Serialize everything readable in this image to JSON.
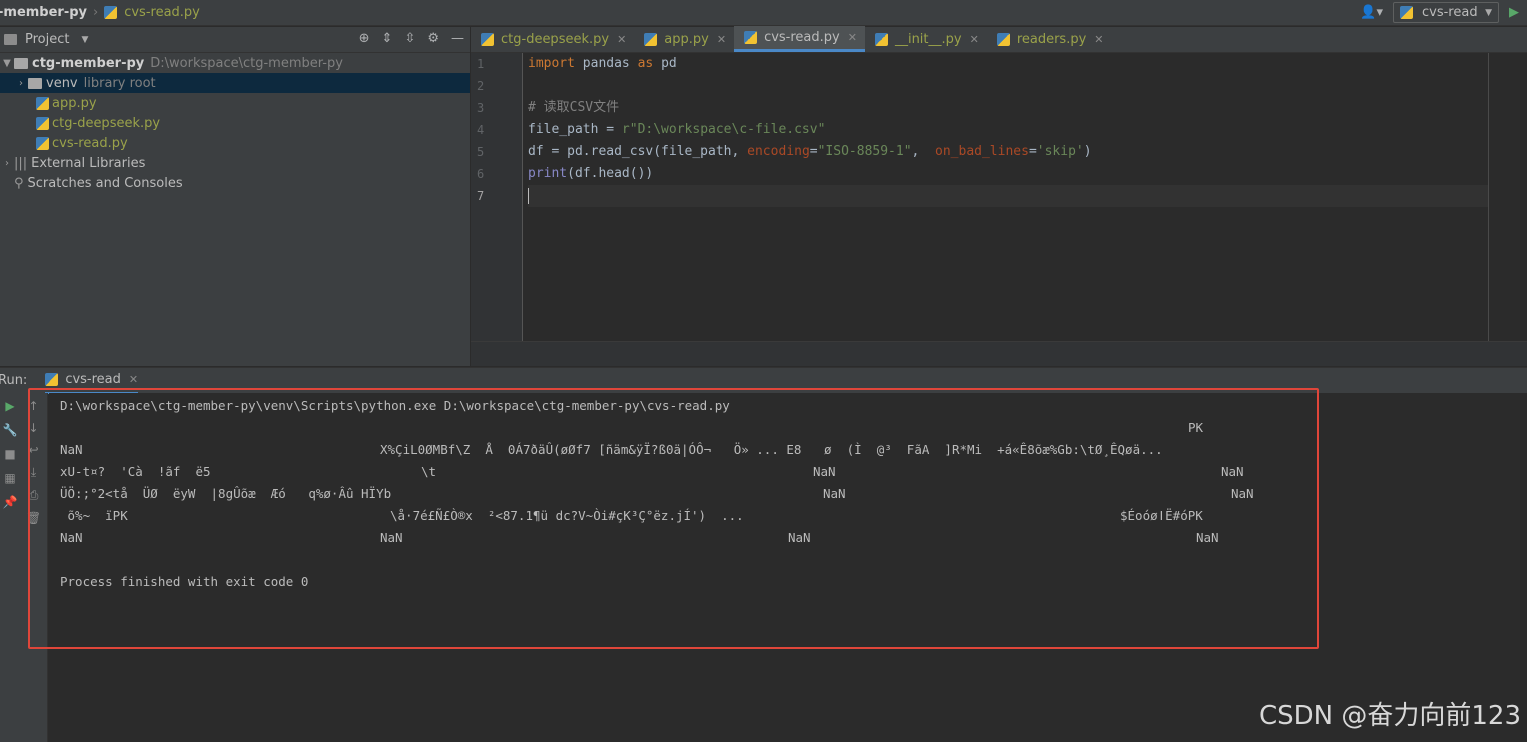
{
  "navbar": {
    "project": "-member-py",
    "file": "cvs-read.py",
    "run_config": "cvs-read"
  },
  "project_panel": {
    "title": "Project",
    "root": {
      "name": "ctg-member-py",
      "path": "D:\\workspace\\ctg-member-py"
    },
    "venv": {
      "name": "venv",
      "hint": "library root"
    },
    "files": [
      "app.py",
      "ctg-deepseek.py",
      "cvs-read.py"
    ],
    "external": "External Libraries",
    "scratches": "Scratches and Consoles"
  },
  "editor": {
    "tabs": [
      "ctg-deepseek.py",
      "app.py",
      "cvs-read.py",
      "__init__.py",
      "readers.py"
    ],
    "active_tab": "cvs-read.py",
    "line_numbers": [
      "1",
      "2",
      "3",
      "4",
      "5",
      "6",
      "7"
    ],
    "code": {
      "l1_kw1": "import",
      "l1_mod": " pandas ",
      "l1_kw2": "as",
      "l1_alias": " pd",
      "l3_comment": "# 读取CSV文件",
      "l4_pre": "file_path = ",
      "l4_str": "r\"D:\\workspace\\c-file.csv\"",
      "l5_pre": "df = pd.read_csv(file_path, ",
      "l5_p1": "encoding",
      "l5_eq1": "=",
      "l5_s1": "\"ISO-8859-1\"",
      "l5_comma": ",  ",
      "l5_p2": "on_bad_lines",
      "l5_eq2": "=",
      "l5_s2": "'skip'",
      "l5_end": ")",
      "l6_fn": "print",
      "l6_rest": "(df.head())"
    }
  },
  "run_panel": {
    "label": "Run:",
    "tab": "cvs-read",
    "console": {
      "cmd": "D:\\workspace\\ctg-member-py\\venv\\Scripts\\python.exe D:\\workspace\\ctg-member-py\\cvs-read.py",
      "r1_right": "PK",
      "r2_c1": "NaN",
      "r2_c2": "X%ÇiL0ØMBf\\Z  Å  0Á7ðäÛ(øØf7 [ñäm&ÿÏ?ß0ä|ÓÔ¬   Ö» ... E8   ø  (Ì  @³  FãA  ]R*Mi  +á«Ê8õæ%Gb:\\tØ¸ÊQøä...",
      "r3_c1": "xU-t¤?  'Cà  !ãf  ë5",
      "r3_c2": "\\t",
      "r3_c3": "NaN",
      "r3_c4": "NaN",
      "r4_c1": "ÜÖ:;°2<tå  ÜØ  ëyW  |8gÛõæ  Æó   q%ø·Âû HÏYb",
      "r4_c2": "NaN",
      "r4_c3": "NaN",
      "r5_c1": " õ%~  ïPK",
      "r5_c2": "\\å·7é£Ñ£Ò®x  ²<87.1¶ü dc?V~Òi#çK³Ç°ëz.jÍ')  ...",
      "r5_c3": "$ÉoóøǀË#óPK",
      "r6_c1": "NaN",
      "r6_c2": "NaN",
      "r6_c3": "NaN",
      "r6_c4": "NaN",
      "finished": "Process finished with exit code 0"
    }
  },
  "watermark": "CSDN @奋力向前123",
  "colors": {
    "accent": "#4a88c7",
    "highlight": "#e0463a"
  }
}
